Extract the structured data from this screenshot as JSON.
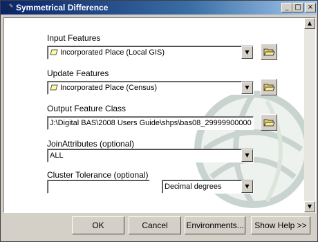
{
  "window": {
    "title": "Symmetrical Difference"
  },
  "title_buttons": {
    "minimize": "_",
    "maximize": "□",
    "close": "×"
  },
  "form": {
    "input_features": {
      "label": "Input Features",
      "value": "Incorporated Place (Local GIS)"
    },
    "update_features": {
      "label": "Update Features",
      "value": "Incorporated Place (Census)"
    },
    "output_feature_class": {
      "label": "Output Feature Class",
      "value": "J:\\Digital BAS\\2008 Users Guide\\shps\\bas08_29999900000"
    },
    "join_attributes": {
      "label": "JoinAttributes (optional)",
      "value": "ALL"
    },
    "cluster_tolerance": {
      "label": "Cluster Tolerance (optional)",
      "value": "",
      "units": "Decimal degrees"
    }
  },
  "buttons": {
    "ok": "OK",
    "cancel": "Cancel",
    "environments": "Environments...",
    "show_help": "Show Help >>"
  },
  "icons": {
    "window": "tool-icon",
    "polygon": "polygon-layer-icon",
    "browse": "open-folder-icon"
  }
}
